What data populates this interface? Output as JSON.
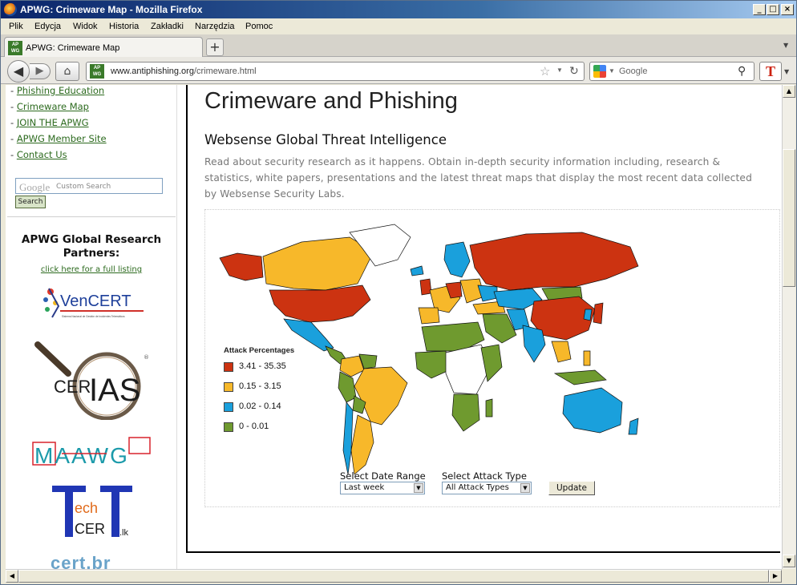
{
  "window": {
    "title": "APWG: Crimeware Map - Mozilla Firefox"
  },
  "menu": [
    "Plik",
    "Edycja",
    "Widok",
    "Historia",
    "Zakładki",
    "Narzędzia",
    "Pomoc"
  ],
  "tab": {
    "label": "APWG: Crimeware Map",
    "favicon_text": "AP WG"
  },
  "nav": {
    "url_host": "www.antiphishing.org",
    "url_path": "/crimeware.html",
    "search_placeholder": "Google"
  },
  "sidebar": {
    "links": [
      {
        "label": "Phishing Education"
      },
      {
        "label": "Crimeware Map"
      },
      {
        "label": "JOIN THE APWG"
      },
      {
        "label": "APWG Member Site"
      },
      {
        "label": "Contact Us"
      }
    ],
    "search_placeholder": "Custom Search",
    "search_logo": "Google",
    "search_button": "Search",
    "partners_title": "APWG Global Research Partners:",
    "listing_link": "click here for a full listing",
    "logos": {
      "vencert": "VenCERT",
      "vencert_sub": "Sistema Nacional de Gestión de Incidentes Telemáticos",
      "cerias_pre": "CER",
      "cerias_main": "IAS",
      "maawg": "MAAWG",
      "techcert_1": "ech",
      "techcert_2": "CER",
      "techcert_3": ".lk",
      "certbr": "cert.br"
    }
  },
  "main": {
    "title": "Crimeware and Phishing",
    "subtitle": "Websense Global Threat Intelligence",
    "intro": "Read about security research as it happens. Obtain in-depth security information including, research & statistics, white papers, presentations and the latest threat maps that display the most recent data collected by Websense Security Labs.",
    "legend": {
      "title": "Attack Percentages",
      "items": [
        {
          "label": "3.41 - 35.35",
          "color": "#cc3311"
        },
        {
          "label": "0.15 - 3.15",
          "color": "#f7b82a"
        },
        {
          "label": "0.02 - 0.14",
          "color": "#1aa0dc"
        },
        {
          "label": "0 - 0.01",
          "color": "#6f9a2f"
        }
      ]
    },
    "controls": {
      "date_label": "Select Date Range",
      "date_value": "Last week",
      "type_label": "Select Attack Type",
      "type_value": "All Attack Types",
      "update_button": "Update"
    }
  },
  "colors": {
    "high": "#cc3311",
    "mid": "#f7b82a",
    "low": "#1aa0dc",
    "none": "#6f9a2f",
    "link": "#2c6a1e"
  }
}
